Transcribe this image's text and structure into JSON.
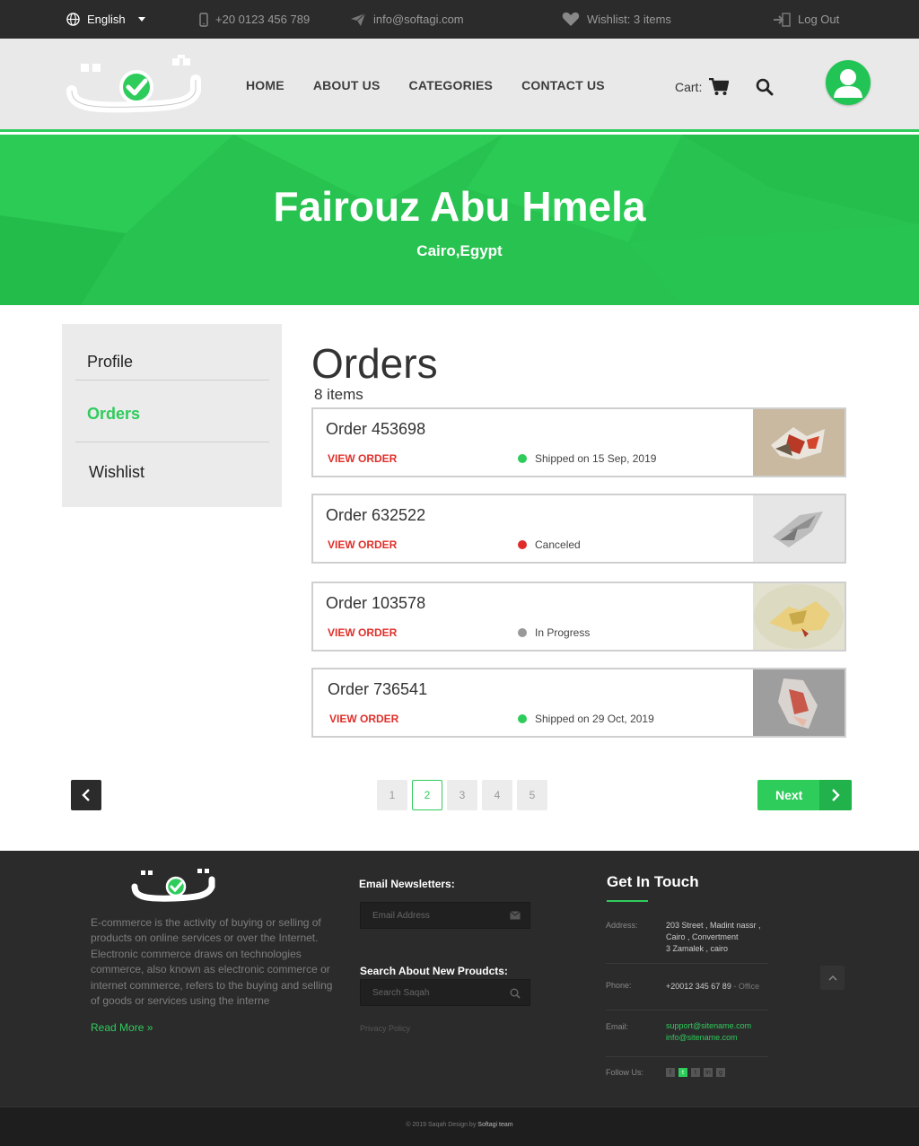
{
  "topbar": {
    "language": "English",
    "phone": "+20 0123 456 789",
    "email": "info@softagi.com",
    "wishlist": "Wishlist: 3 items",
    "logout": "Log Out"
  },
  "nav": {
    "items": [
      "HOME",
      "ABOUT US",
      "CATEGORIES",
      "CONTACT US"
    ],
    "cart_label": "Cart:"
  },
  "hero": {
    "name": "Fairouz Abu Hmela",
    "location": "Cairo,Egypt"
  },
  "sidebar": {
    "items": [
      {
        "label": "Profile",
        "active": false
      },
      {
        "label": "Orders",
        "active": true
      },
      {
        "label": "Wishlist",
        "active": false
      }
    ]
  },
  "orders": {
    "title": "Orders",
    "count": "8 items",
    "view_label": "VIEW ORDER",
    "list": [
      {
        "title": "Order 453698",
        "status": "Shipped on 15 Sep, 2019",
        "status_color": "#2ecc5b"
      },
      {
        "title": "Order 632522",
        "status": "Canceled",
        "status_color": "#e02b2b"
      },
      {
        "title": "Order 103578",
        "status": "In Progress",
        "status_color": "#999999"
      },
      {
        "title": "Order 736541",
        "status": "Shipped on 29 Oct, 2019",
        "status_color": "#2ecc5b"
      }
    ]
  },
  "pagination": {
    "pages": [
      "1",
      "2",
      "3",
      "4",
      "5"
    ],
    "current": 2,
    "next_label": "Next"
  },
  "footer": {
    "about": "E-commerce is the activity of buying or selling of products on online services or over the Internet. Electronic commerce draws on technologies commerce, also known as electronic commerce or internet commerce, refers to the buying and selling of goods or services using the interne",
    "read_more": "Read More »",
    "newsletter_title": "Email Newsletters:",
    "newsletter_placeholder": "Email Address",
    "search_title": "Search About New Proudcts:",
    "search_placeholder": "Search Saqah",
    "privacy": "Privacy Policy",
    "get_in_touch": "Get In Touch",
    "address_label": "Address:",
    "address_lines": [
      "203 Street , Madint nassr ,",
      "Cairo , Convertment",
      "3 Zamalek , cairo"
    ],
    "phone_label": "Phone:",
    "phone_value": "+20012 345 67 89",
    "phone_note": "- Office",
    "email_label": "Email:",
    "emails": [
      "support@sitename.com",
      "info@sitename.com"
    ],
    "follow_label": "Follow Us:",
    "copyright_prefix": "© 2019 Saqah Design by",
    "copyright_brand": "Softagi team"
  },
  "colors": {
    "brand_green": "#2ecc5b",
    "dark": "#2b2b2b",
    "alert_red": "#e0302a"
  }
}
